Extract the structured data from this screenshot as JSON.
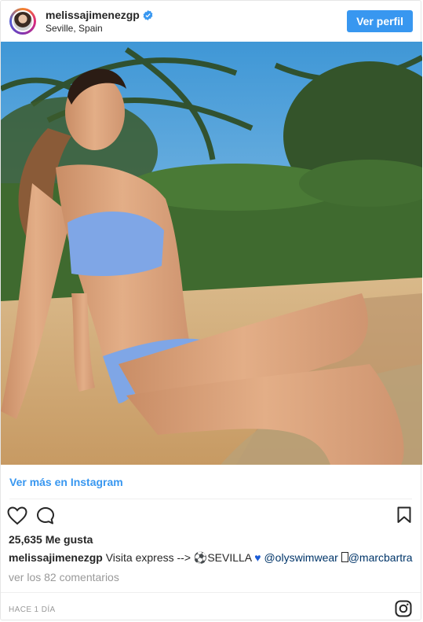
{
  "header": {
    "username": "melissajimenezgp",
    "location": "Seville, Spain",
    "profile_button": "Ver perfil",
    "verified_icon": "verified-badge-icon"
  },
  "link": {
    "label": "Ver más en Instagram"
  },
  "actions": {
    "like_icon": "heart-icon",
    "comment_icon": "comment-icon",
    "save_icon": "bookmark-icon"
  },
  "likes": {
    "text": "25,635 Me gusta"
  },
  "caption": {
    "username": "melissajimenezgp",
    "text_1": "Visita express -->",
    "text_2": "SEVILLA",
    "mention_1": "@olyswimwear",
    "text_3": "",
    "mention_2": "@marcbartra"
  },
  "comments": {
    "label": "ver los 82 comentarios"
  },
  "footer": {
    "timestamp": "HACE 1 DÍA",
    "logo_icon": "instagram-logo-icon"
  },
  "colors": {
    "accent": "#3897f0",
    "mention": "#003569",
    "muted": "#999999"
  }
}
